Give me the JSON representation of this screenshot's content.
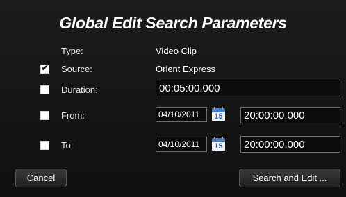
{
  "dialog": {
    "title": "Global Edit Search Parameters"
  },
  "rows": {
    "type": {
      "label": "Type:",
      "value": "Video Clip"
    },
    "source": {
      "label": "Source:",
      "value": "Orient Express",
      "checked": true
    },
    "duration": {
      "label": "Duration:",
      "value": "00:05:00.000",
      "checked": false
    },
    "from": {
      "label": "From:",
      "date": "04/10/2011",
      "time": "20:00:00.000",
      "checked": false
    },
    "to": {
      "label": "To:",
      "date": "04/10/2011",
      "time": "20:00:00.000",
      "checked": false
    }
  },
  "calendar_icon_day": "15",
  "buttons": {
    "cancel": "Cancel",
    "search_and_edit": "Search and Edit ..."
  },
  "colors": {
    "background": "#141414",
    "calendar_accent": "#3e7fcf"
  }
}
